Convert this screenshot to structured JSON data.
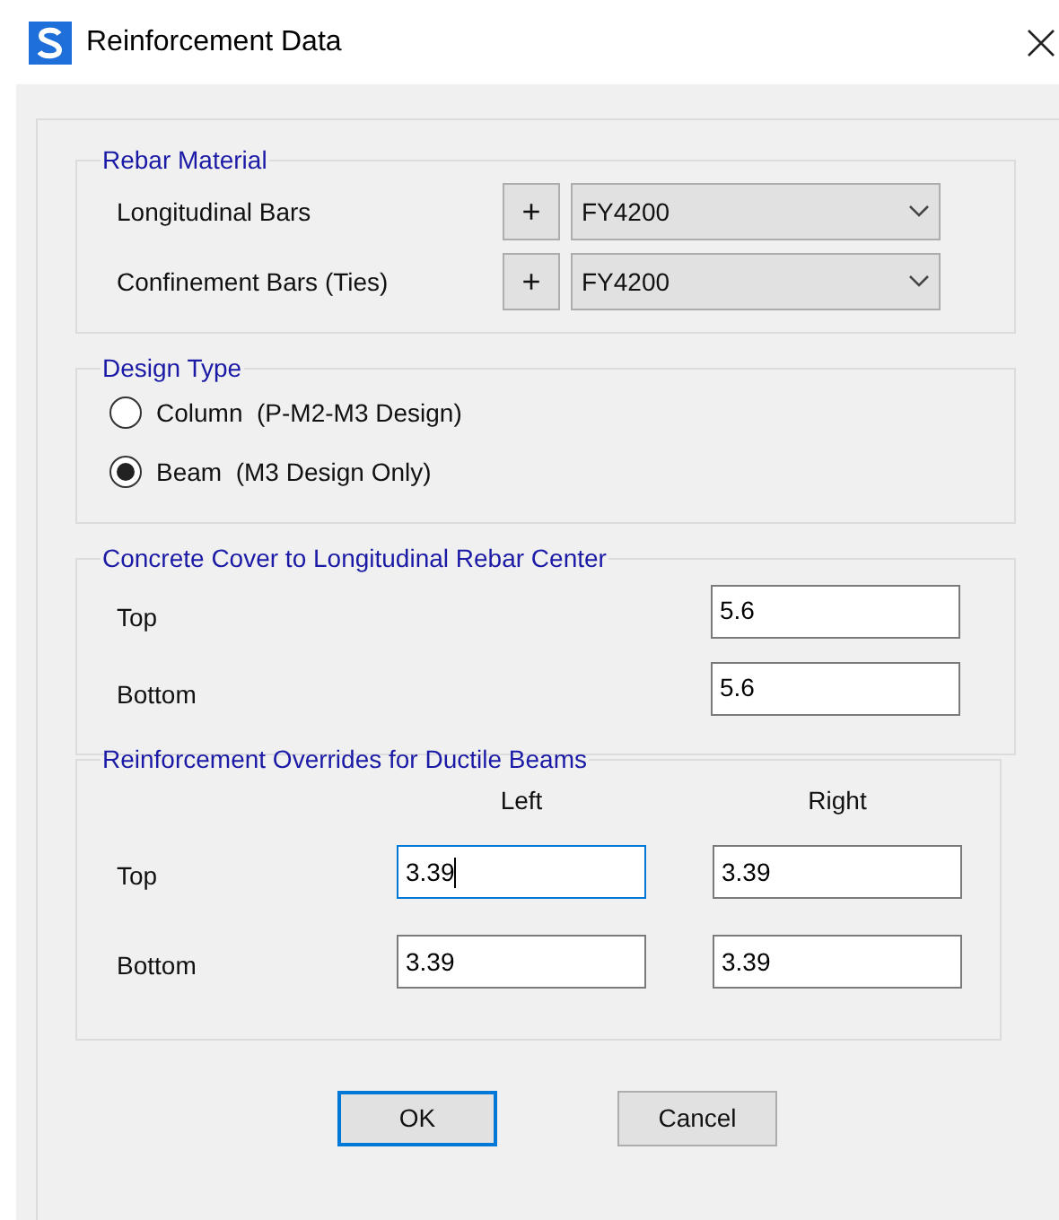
{
  "window": {
    "title": "Reinforcement Data"
  },
  "rebar_material": {
    "title": "Rebar Material",
    "rows": [
      {
        "label": "Longitudinal Bars",
        "add": "+",
        "value": "FY4200"
      },
      {
        "label": "Confinement Bars  (Ties)",
        "add": "+",
        "value": "FY4200"
      }
    ]
  },
  "design_type": {
    "title": "Design Type",
    "options": [
      {
        "label": "Column  (P-M2-M3 Design)",
        "selected": false
      },
      {
        "label": "Beam  (M3 Design Only)",
        "selected": true
      }
    ]
  },
  "concrete_cover": {
    "title": "Concrete Cover to Longitudinal Rebar Center",
    "rows": [
      {
        "label": "Top",
        "value": "5.6"
      },
      {
        "label": "Bottom",
        "value": "5.6"
      }
    ]
  },
  "overrides": {
    "title": "Reinforcement Overrides for Ductile Beams",
    "columns": [
      "Left",
      "Right"
    ],
    "rows": [
      {
        "label": "Top",
        "cells": [
          {
            "value": "3.39",
            "focused": true
          },
          {
            "value": "3.39",
            "focused": false
          }
        ]
      },
      {
        "label": "Bottom",
        "cells": [
          {
            "value": "3.39",
            "focused": false
          },
          {
            "value": "3.39",
            "focused": false
          }
        ]
      }
    ]
  },
  "buttons": [
    {
      "label": "OK",
      "default": true
    },
    {
      "label": "Cancel",
      "default": false
    }
  ]
}
